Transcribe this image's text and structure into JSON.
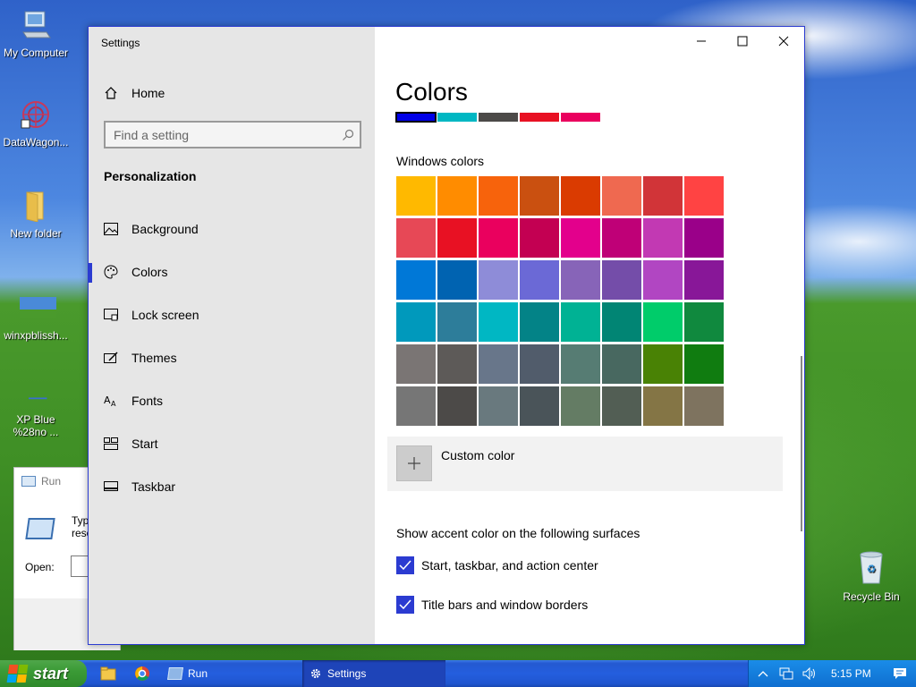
{
  "desktop": {
    "icons": [
      {
        "label": "My Computer"
      },
      {
        "label": "DataWagon..."
      },
      {
        "label": "New folder"
      },
      {
        "label": "winxpblissh..."
      },
      {
        "label": "XP Blue %28no ..."
      },
      {
        "label": "Recycle Bin"
      }
    ]
  },
  "run_dialog": {
    "title": "Run",
    "description_partial_1": "Typ",
    "description_partial_2": "reso",
    "open_label": "Open:"
  },
  "settings": {
    "app_title": "Settings",
    "home_label": "Home",
    "search_placeholder": "Find a setting",
    "section_heading": "Personalization",
    "nav_items": [
      {
        "label": "Background",
        "icon": "picture-icon"
      },
      {
        "label": "Colors",
        "icon": "palette-icon",
        "active": true
      },
      {
        "label": "Lock screen",
        "icon": "lock-screen-icon"
      },
      {
        "label": "Themes",
        "icon": "brush-icon"
      },
      {
        "label": "Fonts",
        "icon": "fonts-icon"
      },
      {
        "label": "Start",
        "icon": "start-icon"
      },
      {
        "label": "Taskbar",
        "icon": "taskbar-icon"
      }
    ],
    "content": {
      "page_title": "Colors",
      "recent_colors": [
        "#0000e8",
        "#00b7c3",
        "#4c4a48",
        "#e81123",
        "#ea005e"
      ],
      "windows_colors_heading": "Windows colors",
      "palette": [
        "#ffb900",
        "#ff8c00",
        "#f7630c",
        "#ca5010",
        "#da3b01",
        "#ef6950",
        "#d13438",
        "#ff4343",
        "#e74856",
        "#e81123",
        "#ea005e",
        "#c30052",
        "#e3008c",
        "#bf0077",
        "#c239b3",
        "#9a0089",
        "#0078d7",
        "#0063b1",
        "#8e8cd8",
        "#6b69d6",
        "#8764b8",
        "#744da9",
        "#b146c2",
        "#881798",
        "#0099bc",
        "#2d7d9a",
        "#00b7c3",
        "#038387",
        "#00b294",
        "#018574",
        "#00cc6a",
        "#10893e",
        "#7a7574",
        "#5d5a58",
        "#68768a",
        "#515c6b",
        "#567c73",
        "#486860",
        "#498205",
        "#107c10",
        "#767676",
        "#4c4a48",
        "#69797e",
        "#4a5459",
        "#647c64",
        "#525e54",
        "#847545",
        "#7e735f"
      ],
      "custom_color_label": "Custom color",
      "surfaces_heading": "Show accent color on the following surfaces",
      "checkboxes": [
        {
          "label": "Start, taskbar, and action center",
          "checked": true
        },
        {
          "label": "Title bars and window borders",
          "checked": true
        }
      ],
      "accent_color": "#2b3bd1"
    }
  },
  "taskbar": {
    "start_label": "start",
    "tasks": [
      {
        "label": "Run"
      },
      {
        "label": "Settings",
        "active": true
      }
    ],
    "clock": "5:15 PM"
  }
}
